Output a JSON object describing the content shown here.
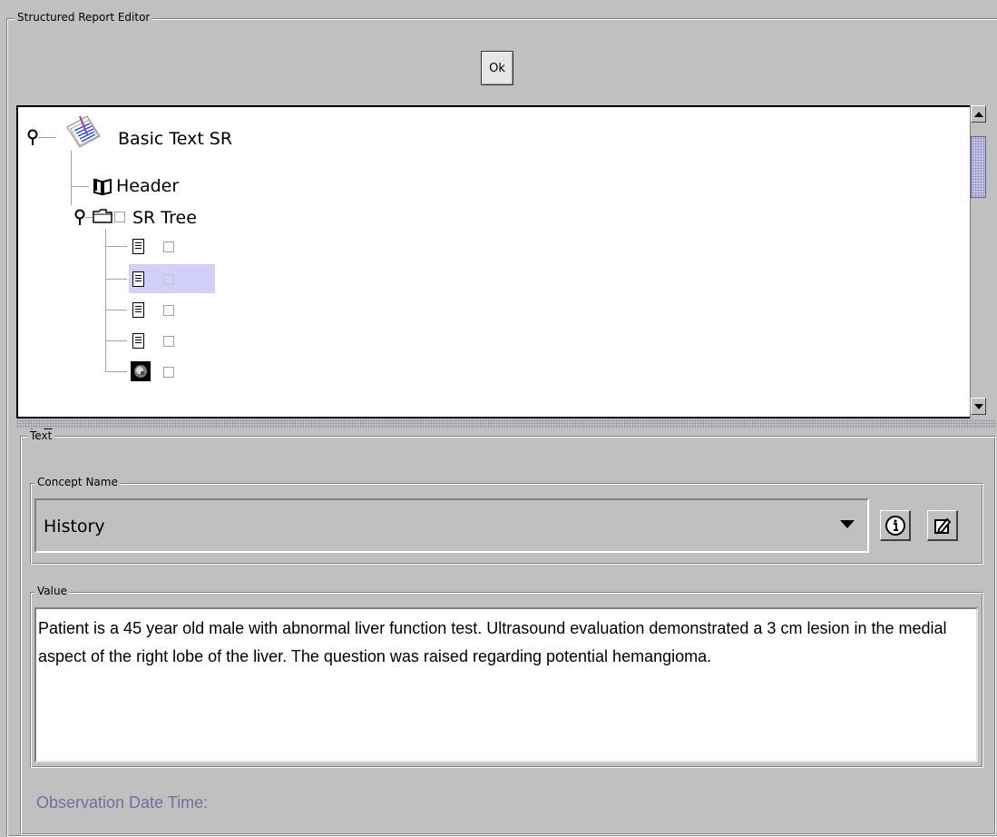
{
  "window": {
    "title": "Structured Report Editor"
  },
  "toolbar": {
    "ok_label": "Ok"
  },
  "tree": {
    "root": {
      "label": "Basic Text SR",
      "icon": "report-document-icon"
    },
    "header": {
      "label": "Header",
      "icon": "book-icon"
    },
    "sr_tree": {
      "label": "SR Tree",
      "icon": "folder-icon"
    },
    "children": [
      {
        "icon": "text-document-icon",
        "selected": false
      },
      {
        "icon": "text-document-icon",
        "selected": true
      },
      {
        "icon": "text-document-icon",
        "selected": false
      },
      {
        "icon": "text-document-icon",
        "selected": false
      },
      {
        "icon": "image-icon",
        "selected": false
      }
    ]
  },
  "details": {
    "section_label": "Text",
    "concept_name": {
      "label": "Concept Name",
      "value": "History",
      "info_icon": "info-icon",
      "edit_icon": "edit-icon"
    },
    "value": {
      "label": "Value",
      "text": "Patient is a 45 year old male with abnormal liver function test. Ultrasound evaluation demonstrated a 3 cm lesion in the medial aspect of the right lobe of the liver. The question was raised regarding potential hemangioma."
    },
    "observation_label": "Observation Date Time:"
  },
  "colors": {
    "selection": "#d0d0f8",
    "panel_bg": "#c0c0c0",
    "observation_text": "#6f6fa0"
  }
}
